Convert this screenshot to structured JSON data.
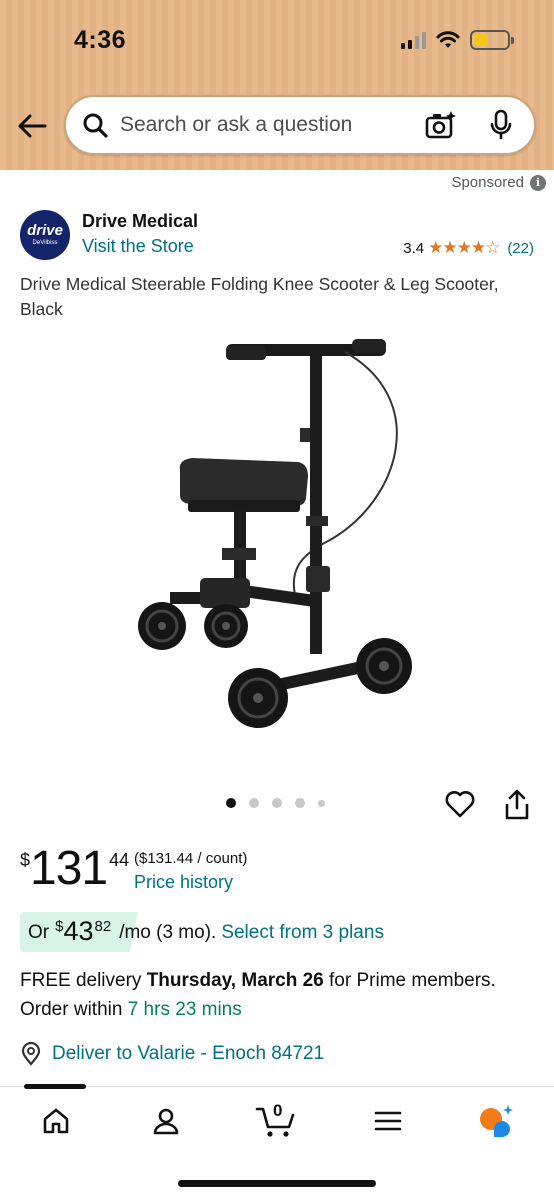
{
  "status": {
    "time": "4:36"
  },
  "search": {
    "placeholder": "Search or ask a question"
  },
  "sponsored_label": "Sponsored",
  "brand": {
    "logo_word": "drive",
    "logo_sub": "DeVilbiss",
    "name": "Drive Medical",
    "visit_store": "Visit the Store"
  },
  "rating": {
    "value": "3.4",
    "count": "(22)",
    "stars": "★★★★☆",
    "score": 3.4
  },
  "product": {
    "title": "Drive Medical Steerable Folding Knee Scooter & Leg Scooter, Black",
    "image_count": 5,
    "active_image": 1
  },
  "price": {
    "symbol": "$",
    "whole": "131",
    "fraction": "44",
    "unit": "($131.44 / count)",
    "history_link": "Price history"
  },
  "monthly": {
    "prefix": "Or",
    "symbol": "$",
    "whole": "43",
    "fraction": "82",
    "term": "/mo (3 mo).",
    "plans_link": "Select from 3 plans",
    "badge_color": "#d8f3e7"
  },
  "delivery": {
    "prefix": "FREE delivery ",
    "date": "Thursday, March 26",
    "middle": " for Prime members. Order within ",
    "countdown": "7 hrs 23 mins"
  },
  "deliver_to": "Deliver to Valarie - Enoch 84721",
  "nav": {
    "items": [
      "home-icon",
      "account-icon",
      "cart-icon",
      "menu-icon",
      "rufus-icon"
    ],
    "cart_count": "0"
  },
  "colors": {
    "header_bg": "#e8b98a",
    "link": "#007185",
    "star": "#de7921",
    "green": "#067d62"
  }
}
